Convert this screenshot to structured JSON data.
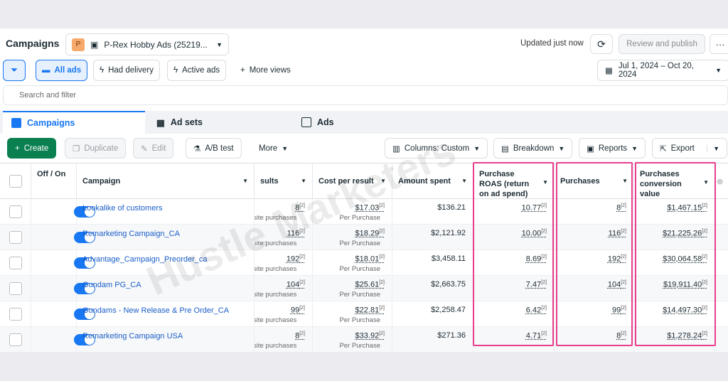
{
  "header": {
    "title": "Campaigns",
    "account_initial": "P",
    "account_name": "P-Rex Hobby Ads (25219...",
    "updated": "Updated just now",
    "review_label": "Review and publish",
    "more_label": "···"
  },
  "filters": {
    "all_ads": "All ads",
    "had_delivery": "Had delivery",
    "active_ads": "Active ads",
    "more_views": "More views",
    "date_range": "Jul 1, 2024 – Oct 20, 2024"
  },
  "search": {
    "placeholder": "Search and filter"
  },
  "tabs": {
    "campaigns": "Campaigns",
    "ad_sets": "Ad sets",
    "ads": "Ads"
  },
  "toolbar": {
    "create": "Create",
    "duplicate": "Duplicate",
    "edit": "Edit",
    "ab_test": "A/B test",
    "more": "More",
    "columns": "Columns: Custom",
    "breakdown": "Breakdown",
    "reports": "Reports",
    "export": "Export"
  },
  "columns": {
    "off_on": "Off / On",
    "campaign": "Campaign",
    "results": "sults",
    "cost_per_result": "Cost per result",
    "amount_spent": "Amount spent",
    "roas": "Purchase ROAS (return on ad spend)",
    "purchases": "Purchases",
    "conv_value": "Purchases conversion value"
  },
  "rows": [
    {
      "name": "Lookalike of customers",
      "results": "8",
      "results_sub": "site purchases",
      "cpr": "$17.03",
      "cpr_sub": "Per Purchase",
      "spent": "$136.21",
      "roas": "10.77",
      "purchases": "8",
      "value": "$1,467.15"
    },
    {
      "name": "Remarketing Campaign_CA",
      "results": "116",
      "results_sub": "site purchases",
      "cpr": "$18.29",
      "cpr_sub": "Per Purchase",
      "spent": "$2,121.92",
      "roas": "10.00",
      "purchases": "116",
      "value": "$21,225.26"
    },
    {
      "name": "Advantage_Campaign_Preorder_ca",
      "results": "192",
      "results_sub": "site purchases",
      "cpr": "$18.01",
      "cpr_sub": "Per Purchase",
      "spent": "$3,458.11",
      "roas": "8.69",
      "purchases": "192",
      "value": "$30,064.58"
    },
    {
      "name": "Gundam PG_CA",
      "results": "104",
      "results_sub": "site purchases",
      "cpr": "$25.61",
      "cpr_sub": "Per Purchase",
      "spent": "$2,663.75",
      "roas": "7.47",
      "purchases": "104",
      "value": "$19,911.40"
    },
    {
      "name": "Gundams - New Release & Pre Order_CA",
      "results": "99",
      "results_sub": "site purchases",
      "cpr": "$22.81",
      "cpr_sub": "Per Purchase",
      "spent": "$2,258.47",
      "roas": "6.42",
      "purchases": "99",
      "value": "$14,497.30"
    },
    {
      "name": "Remarketing Campaign USA",
      "results": "8",
      "results_sub": "site purchases",
      "cpr": "$33.92",
      "cpr_sub": "Per Purchase",
      "spent": "$271.36",
      "roas": "4.71",
      "purchases": "8",
      "value": "$1,278.24"
    }
  ],
  "footnote": "[2]",
  "watermark": "Hustle Marketers",
  "colors": {
    "accent": "#1877f2",
    "create": "#0a7f50",
    "highlight": "#e83e8c"
  }
}
